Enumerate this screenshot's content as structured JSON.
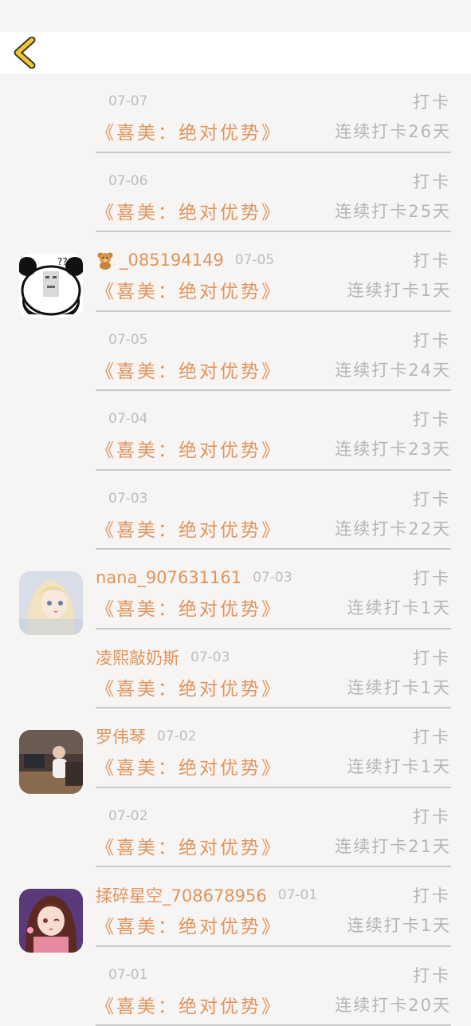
{
  "status_bar": {},
  "header": {
    "back_icon": "chevron-left-icon"
  },
  "colors": {
    "accent": "#e0955c",
    "muted": "#b5b5b5",
    "background": "#f7f4f4",
    "back_icon": "#f0c832"
  },
  "list": [
    {
      "avatar": null,
      "username": "",
      "date": "07-07",
      "action": "打卡",
      "book": "《喜美：绝对优势》",
      "streak": "连续打卡26天"
    },
    {
      "avatar": null,
      "username": "",
      "date": "07-06",
      "action": "打卡",
      "book": "《喜美：绝对优势》",
      "streak": "连续打卡25天"
    },
    {
      "avatar": "panda",
      "username": "_085194149",
      "user_icon": "teddy-bear-icon",
      "date": "07-05",
      "action": "打卡",
      "book": "《喜美：绝对优势》",
      "streak": "连续打卡1天"
    },
    {
      "avatar": null,
      "username": "",
      "date": "07-05",
      "action": "打卡",
      "book": "《喜美：绝对优势》",
      "streak": "连续打卡24天"
    },
    {
      "avatar": null,
      "username": "",
      "date": "07-04",
      "action": "打卡",
      "book": "《喜美：绝对优势》",
      "streak": "连续打卡23天"
    },
    {
      "avatar": null,
      "username": "",
      "date": "07-03",
      "action": "打卡",
      "book": "《喜美：绝对优势》",
      "streak": "连续打卡22天"
    },
    {
      "avatar": "anime-blonde",
      "username": "nana_907631161",
      "date": "07-03",
      "action": "打卡",
      "book": "《喜美：绝对优势》",
      "streak": "连续打卡1天"
    },
    {
      "avatar": null,
      "username": "凌熙敲奶斯",
      "date": "07-03",
      "action": "打卡",
      "book": "《喜美：绝对优势》",
      "streak": "连续打卡1天"
    },
    {
      "avatar": "photo-desk",
      "username": "罗伟琴",
      "date": "07-02",
      "action": "打卡",
      "book": "《喜美：绝对优势》",
      "streak": "连续打卡1天"
    },
    {
      "avatar": null,
      "username": "",
      "date": "07-02",
      "action": "打卡",
      "book": "《喜美：绝对优势》",
      "streak": "连续打卡21天"
    },
    {
      "avatar": "anime-brunette",
      "username": "揉碎星空_708678956",
      "date": "07-01",
      "action": "打卡",
      "book": "《喜美：绝对优势》",
      "streak": "连续打卡1天"
    },
    {
      "avatar": null,
      "username": "",
      "date": "07-01",
      "action": "打卡",
      "book": "《喜美：绝对优势》",
      "streak": "连续打卡20天"
    }
  ]
}
